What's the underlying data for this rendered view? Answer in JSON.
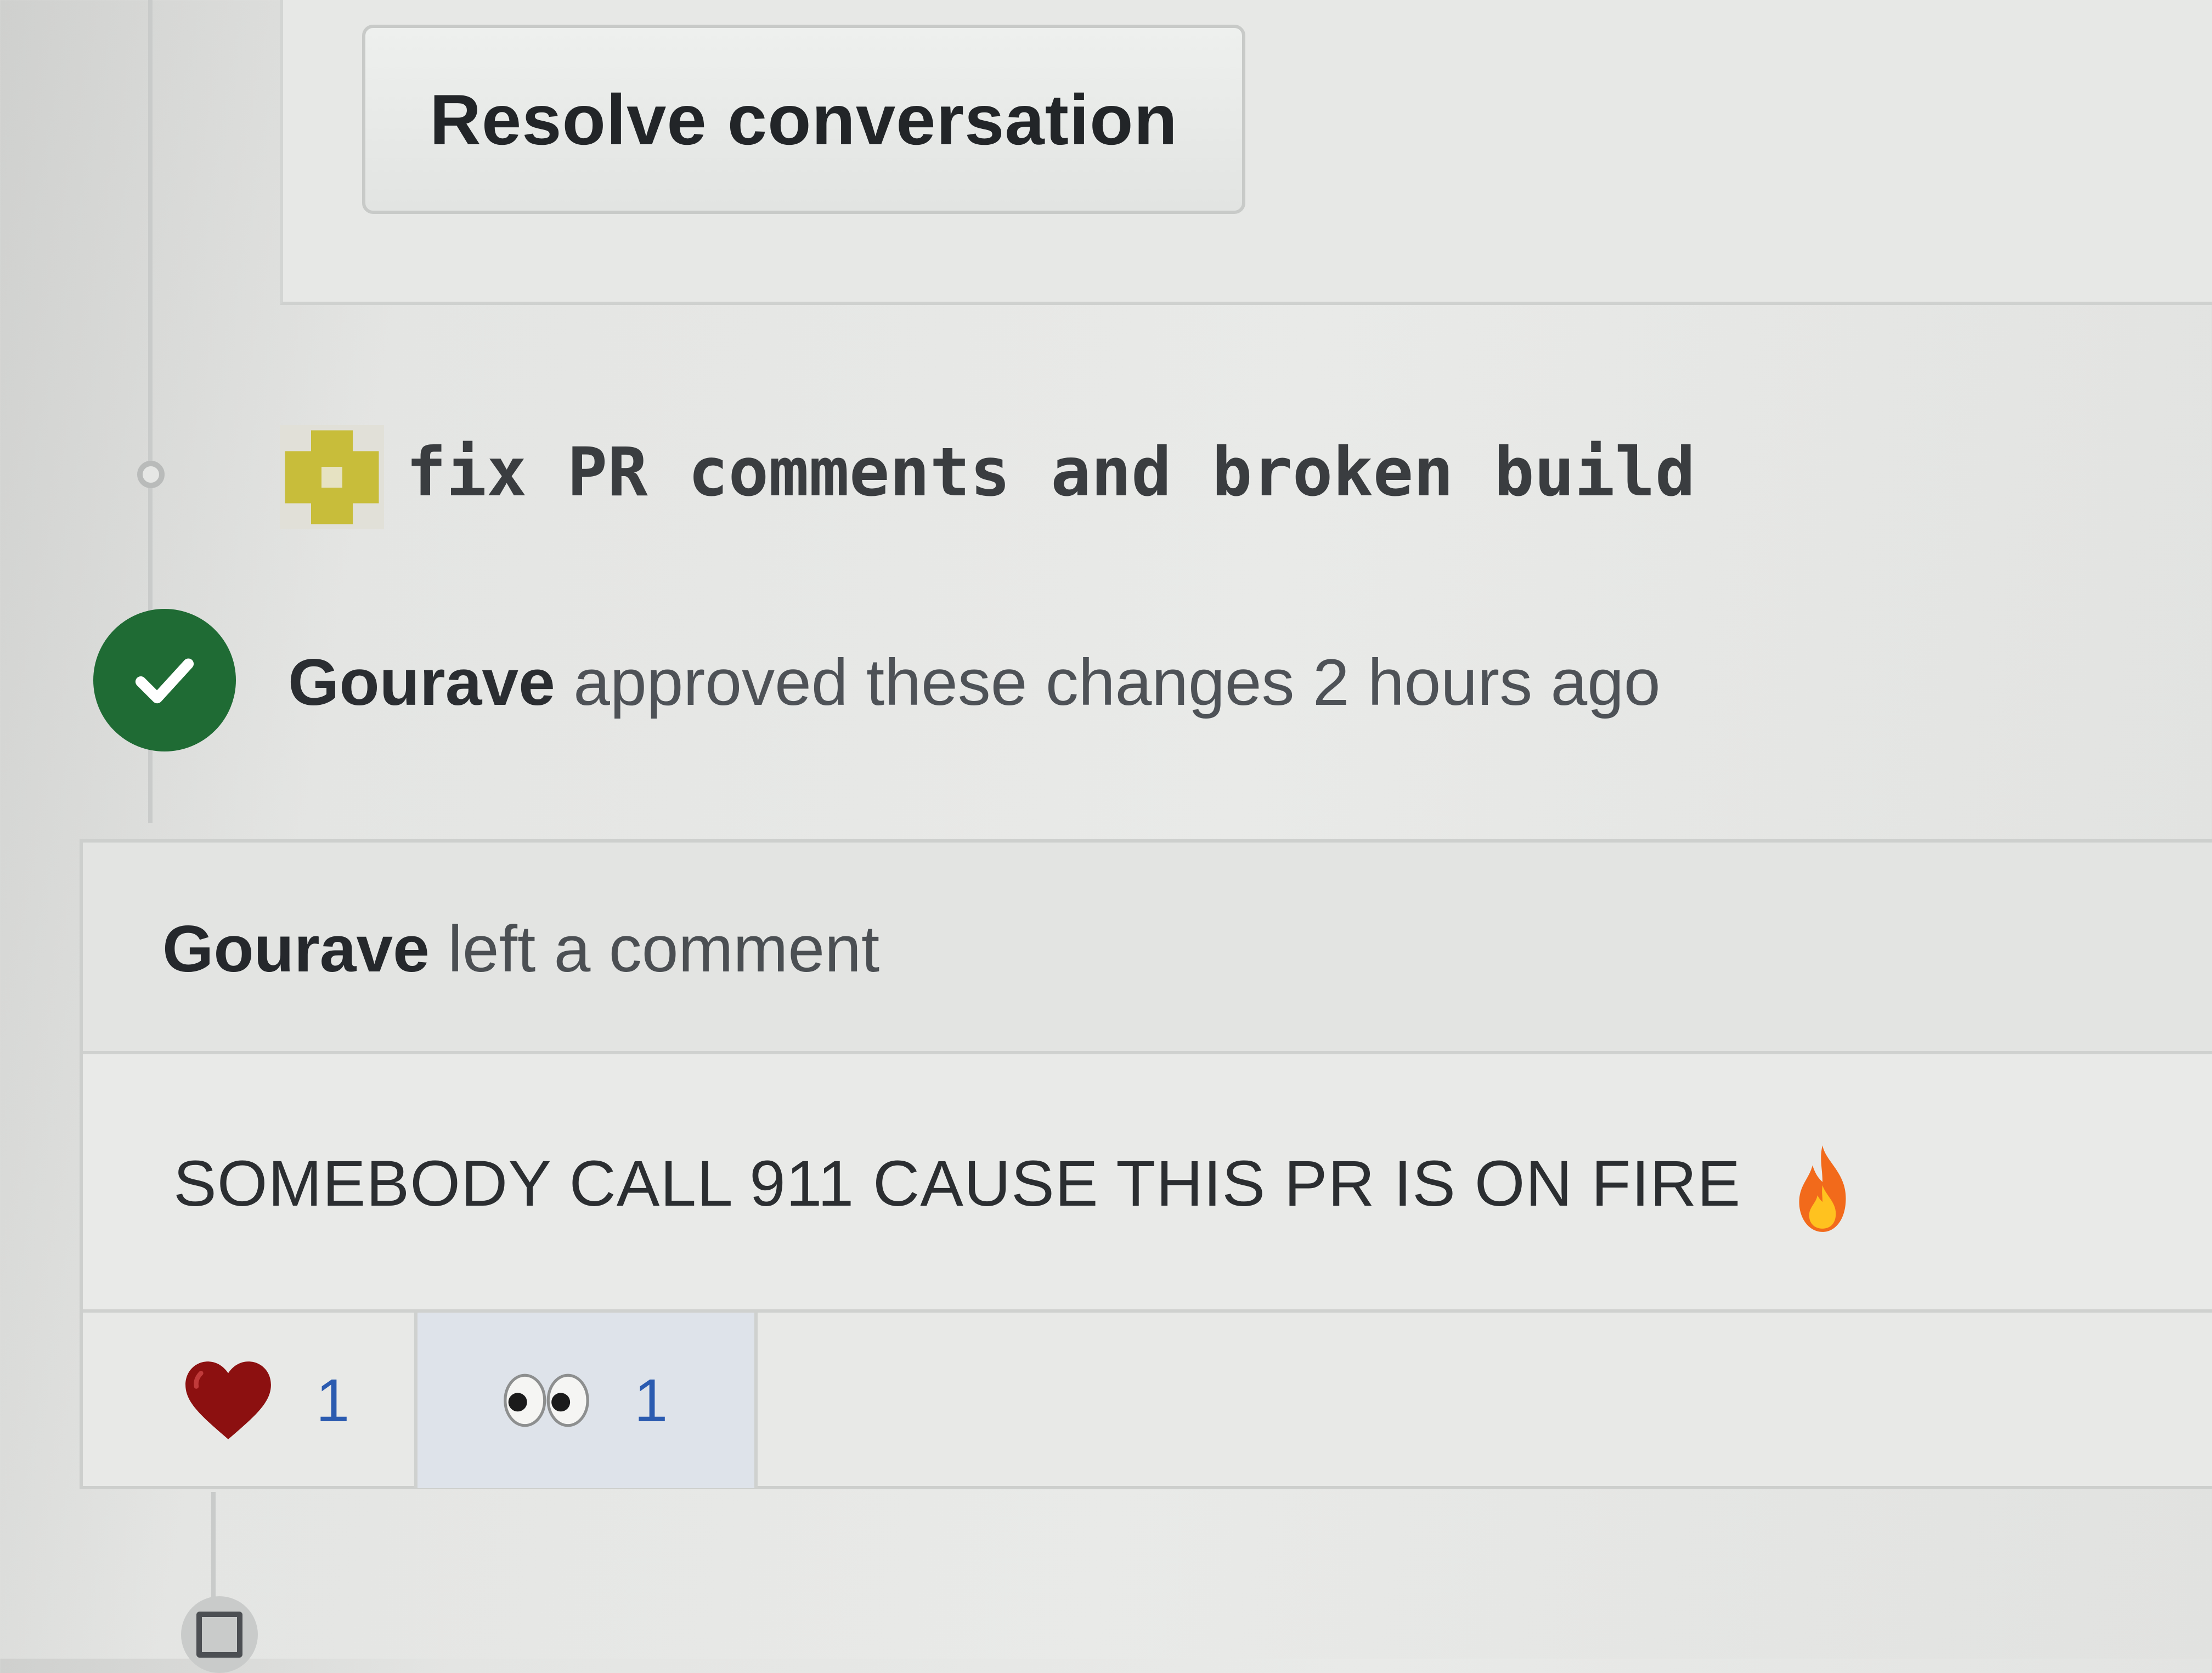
{
  "review_thread": {
    "resolve_button_label": "Resolve conversation"
  },
  "commit": {
    "message": "fix PR comments and broken build",
    "icon": "commit-avatar-icon"
  },
  "approval": {
    "author": "Gourave",
    "action_text": "approved these changes 2 hours ago",
    "status_color": "#1f6b34",
    "icon": "check-icon"
  },
  "comment": {
    "author": "Gourave",
    "header_action": "left a comment",
    "body": "SOMEBODY CALL 911 CAUSE THIS PR IS ON FIRE",
    "body_emoji": "fire-icon",
    "reactions": [
      {
        "icon": "heart-icon",
        "count": "1"
      },
      {
        "icon": "eyes-icon",
        "count": "1"
      }
    ]
  },
  "next_event": {
    "icon": "repo-push-icon"
  }
}
